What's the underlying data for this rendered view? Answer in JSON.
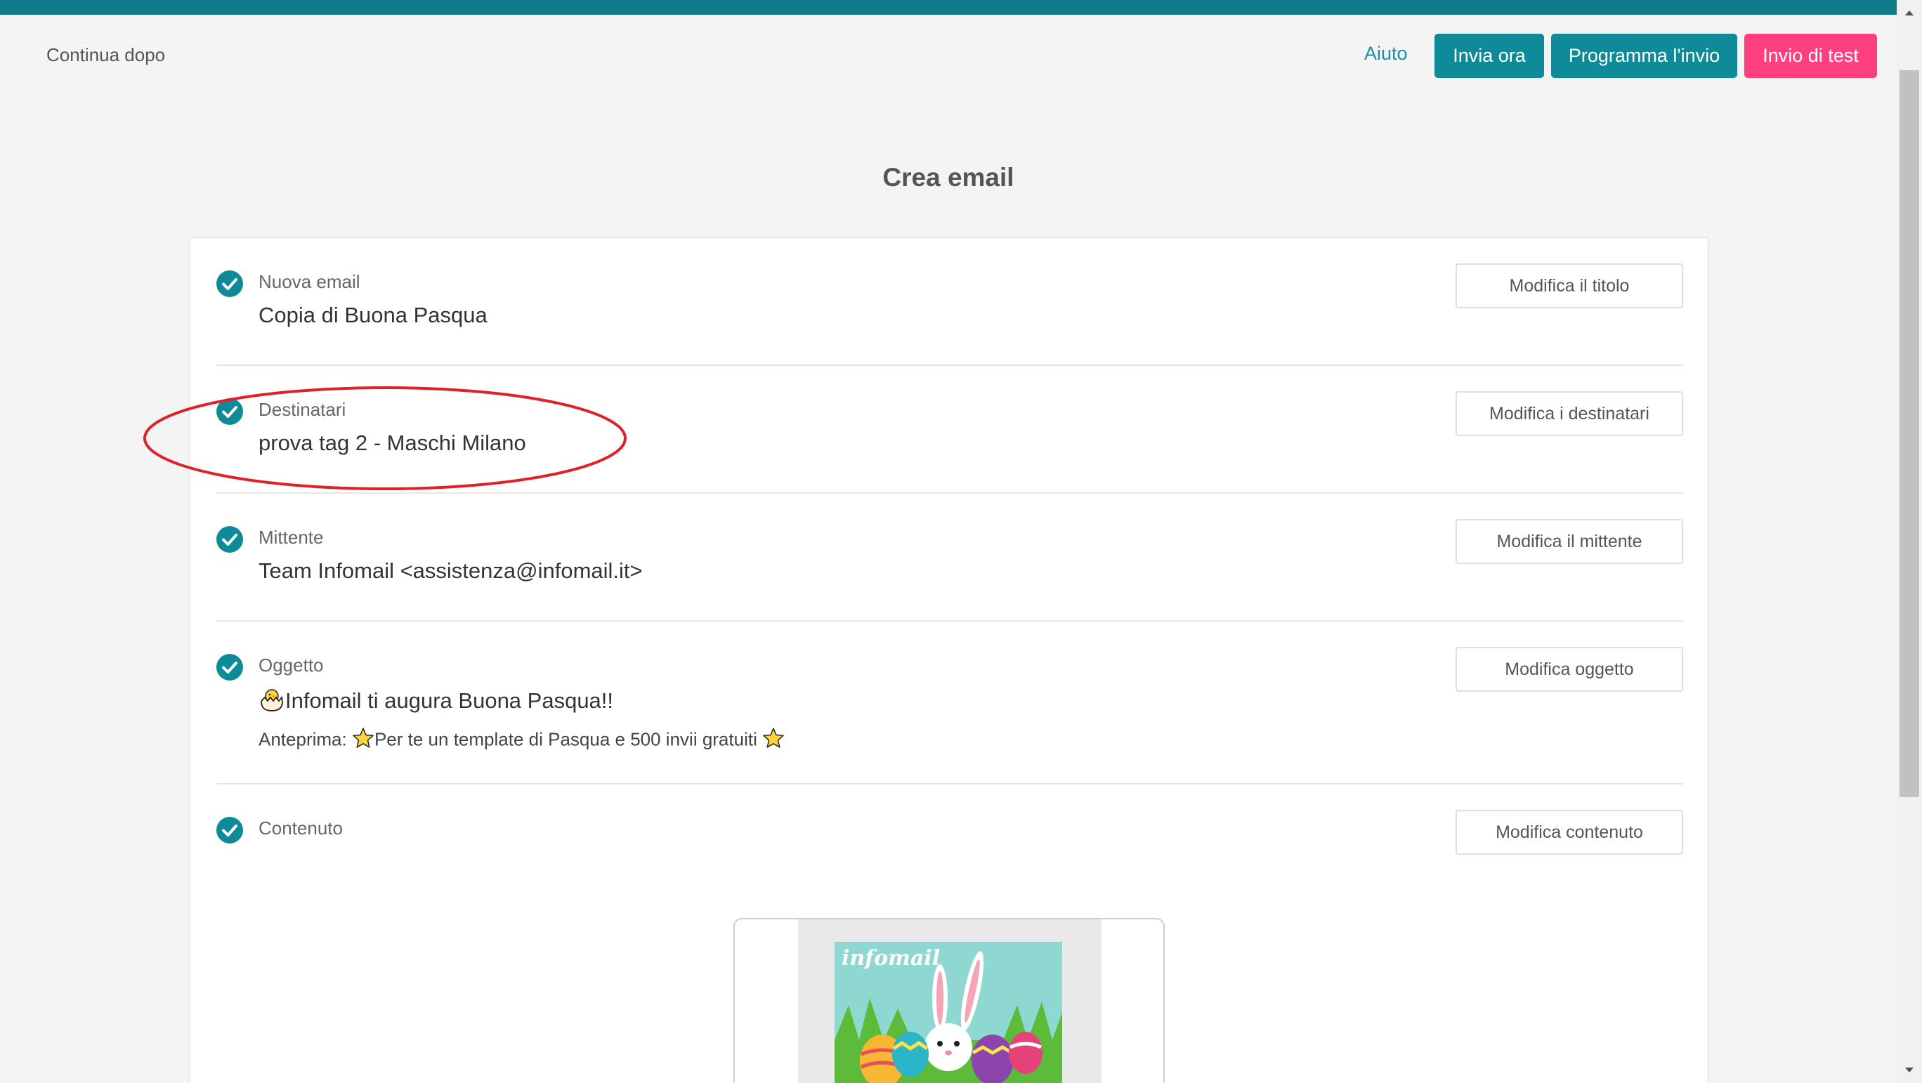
{
  "header": {
    "continue_label": "Continua dopo",
    "help_label": "Aiuto",
    "send_now_label": "Invia ora",
    "schedule_label": "Programma l'invio",
    "test_label": "Invio di test"
  },
  "page": {
    "title": "Crea email"
  },
  "sections": {
    "title": {
      "label": "Nuova email",
      "value": "Copia di Buona Pasqua",
      "button": "Modifica il titolo"
    },
    "recipients": {
      "label": "Destinatari",
      "value": "prova tag 2 - Maschi Milano",
      "button": "Modifica i destinatari"
    },
    "sender": {
      "label": "Mittente",
      "value": "Team Infomail <assistenza@infomail.it>",
      "button": "Modifica il mittente"
    },
    "subject": {
      "label": "Oggetto",
      "value": "Infomail ti augura Buona Pasqua!!",
      "preview_prefix": "Anteprima:",
      "preview_text": "Per te un template di Pasqua e 500 invii gratuiti",
      "button": "Modifica oggetto"
    },
    "content": {
      "label": "Contenuto",
      "button": "Modifica contenuto"
    }
  },
  "email_preview": {
    "logo_text": "infomail"
  },
  "colors": {
    "accent": "#0e8a98",
    "test_button": "#ff3f7f",
    "annotation": "#e0202a"
  },
  "icons": {
    "check": "check-circle-icon",
    "chick": "hatching-chick-icon",
    "star": "star-icon"
  }
}
